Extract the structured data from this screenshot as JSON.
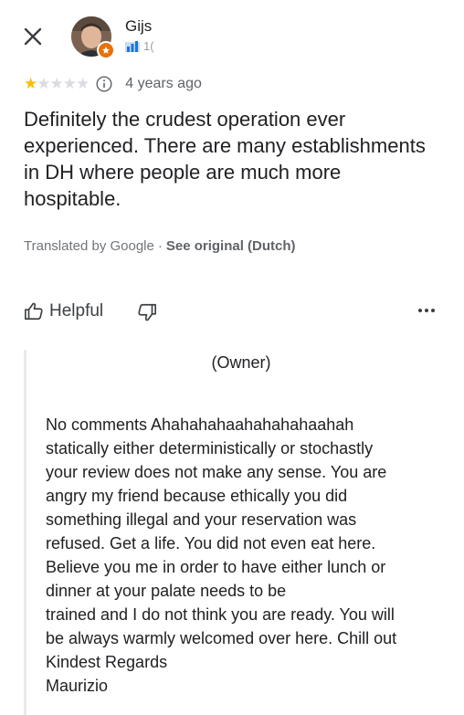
{
  "header": {
    "close_icon": "close-icon",
    "reviewer_name": "Gijs",
    "reviewer_meta_icon": "local-guide-chart-icon",
    "reviewer_meta_text": "1("
  },
  "rating": {
    "stars_filled": 1,
    "stars_total": 5,
    "star_on_color": "#fbbc04",
    "star_off_color": "#dadce0",
    "info_icon": "info-icon",
    "time": "4 years ago"
  },
  "review": {
    "text": "Definitely the crudest operation ever experienced. There are many establishments in DH where people are much more hospitable.",
    "translated_by": "Translated by Google",
    "separator": "·",
    "see_original": "See original (Dutch)"
  },
  "actions": {
    "helpful_label": "Helpful",
    "helpful_icon": "thumbs-up-icon",
    "not_helpful_icon": "thumbs-down-icon",
    "more_icon": "more-horizontal-icon"
  },
  "owner_response": {
    "label": "(Owner)",
    "text": "No comments Ahahahahaahahahahaahah\nstatically either deterministically or stochastly\nyour review does not make any sense. You are\nangry my friend because ethically you did\nsomething illegal and your reservation was\nrefused. Get a life.  You did not even eat here.\nBelieve you me in order to have either lunch or\ndinner at                          your palate needs to be\ntrained and I do not think you are ready. You will\nbe always warmly welcomed over here. Chill out\nKindest Regards\nMaurizio"
  }
}
